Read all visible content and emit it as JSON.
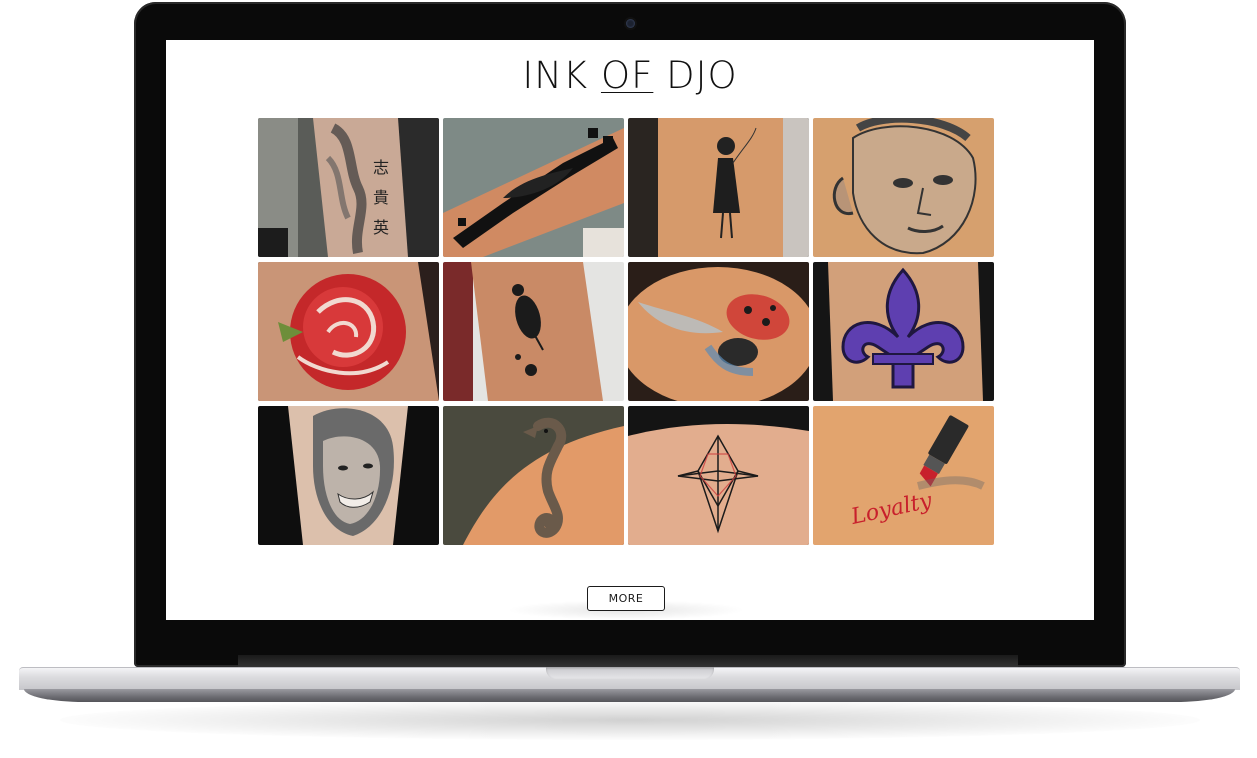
{
  "site": {
    "logo_part1": "INK ",
    "logo_part2": "OF",
    "logo_part3": " DJO"
  },
  "gallery": {
    "tiles": [
      {
        "subject": "arm with black-grey samurai and kanji tattoo",
        "icon": "samurai-tattoo-image"
      },
      {
        "subject": "forearm with black tribal feather tattoo",
        "icon": "tribal-tattoo-image"
      },
      {
        "subject": "forearm with girl holding balloon tattoo",
        "icon": "girl-balloon-tattoo-image"
      },
      {
        "subject": "shoulder with statue face tattoo",
        "icon": "statue-face-tattoo-image"
      },
      {
        "subject": "red rose tattoo",
        "icon": "rose-tattoo-image"
      },
      {
        "subject": "forearm with bird silhouette tattoo",
        "icon": "bird-tattoo-image"
      },
      {
        "subject": "ladybug tattoo",
        "icon": "ladybug-tattoo-image"
      },
      {
        "subject": "purple fleur-de-lis tattoo",
        "icon": "fleur-de-lis-tattoo-image"
      },
      {
        "subject": "smiling portrait tattoo",
        "icon": "portrait-tattoo-image"
      },
      {
        "subject": "seahorse tattoo",
        "icon": "seahorse-tattoo-image"
      },
      {
        "subject": "geometric star tattoo",
        "icon": "geometric-tattoo-image"
      },
      {
        "subject": "lipstick and Loyalty script tattoo",
        "icon": "lipstick-tattoo-image",
        "script_text": "Loyalty"
      }
    ]
  },
  "actions": {
    "more_label": "MORE"
  },
  "colors": {
    "bezel": "#0a0a0a",
    "screen_bg": "#ffffff",
    "button_border": "#1b1b1b"
  }
}
